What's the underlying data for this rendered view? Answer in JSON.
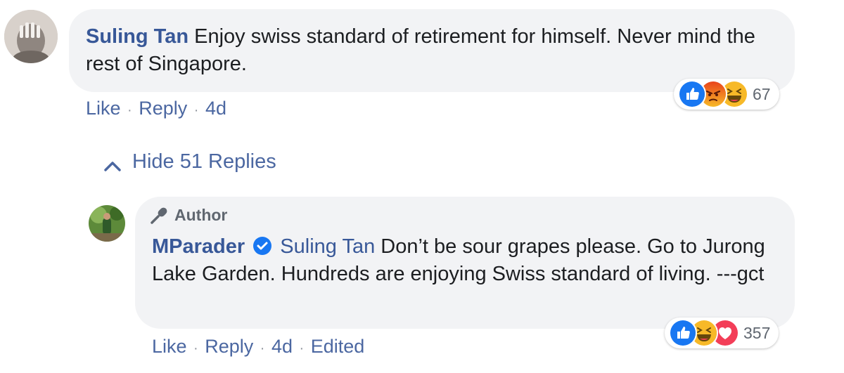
{
  "comment": {
    "author": "Suling Tan",
    "text": "Enjoy swiss standard of retirement for himself. Never mind the rest of Singapore.",
    "like_label": "Like",
    "reply_label": "Reply",
    "separator": "·",
    "time": "4d",
    "reactions": {
      "icons": [
        "like-icon",
        "angry-icon",
        "haha-icon"
      ],
      "count": "67"
    }
  },
  "hide_replies_label": "Hide 51 Replies",
  "reply": {
    "badge": "Author",
    "author": "MParader",
    "verified": true,
    "mention": "Suling Tan",
    "text": "Don’t be sour grapes please. Go to Jurong Lake Garden. Hundreds are enjoying Swiss standard of living. ---gct",
    "like_label": "Like",
    "reply_label": "Reply",
    "separator": "·",
    "time": "4d",
    "edited_label": "Edited",
    "reactions": {
      "icons": [
        "like-icon",
        "haha-icon",
        "love-icon"
      ],
      "count": "357"
    }
  },
  "colors": {
    "link": "#385898",
    "bubble": "#f2f3f5",
    "meta": "#90949c",
    "like_blue": "#1877f2",
    "angry_orange": "#e9710f",
    "haha_yellow": "#f7b928",
    "love_red": "#f33e58"
  }
}
